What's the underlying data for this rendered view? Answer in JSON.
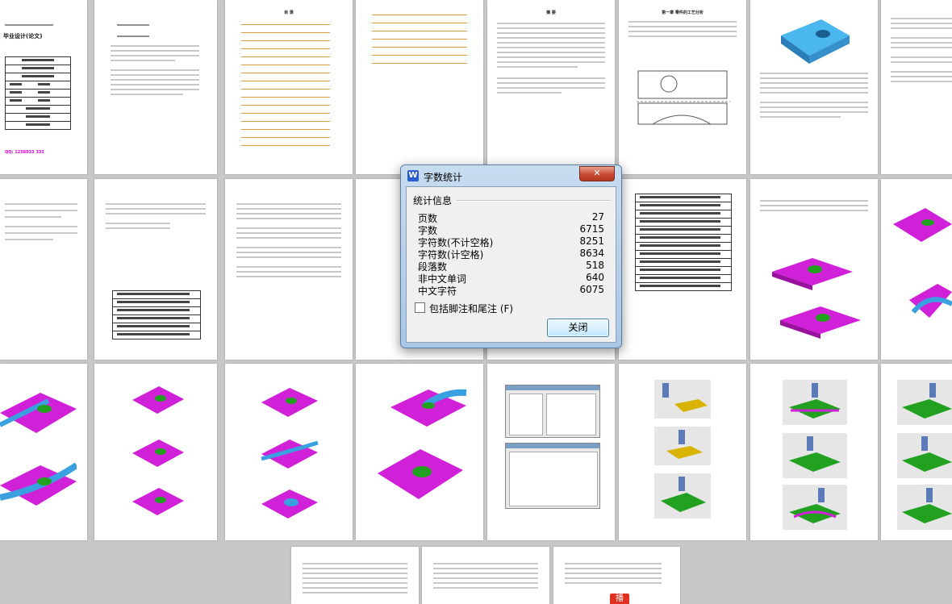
{
  "dialog": {
    "title": "字数统计",
    "close_glyph": "✕",
    "app_icon_letter": "W",
    "group_label": "统计信息",
    "stats": [
      {
        "label": "页数",
        "value": "27"
      },
      {
        "label": "字数",
        "value": "6715"
      },
      {
        "label": "字符数(不计空格)",
        "value": "8251"
      },
      {
        "label": "字符数(计空格)",
        "value": "8634"
      },
      {
        "label": "段落数",
        "value": "518"
      },
      {
        "label": "非中文单词",
        "value": "640"
      },
      {
        "label": "中文字符",
        "value": "6075"
      }
    ],
    "checkbox_label": "包括脚注和尾注 (F)",
    "checkbox_checked": false,
    "close_button_label": "关闭"
  },
  "pages": {
    "cover_title": "毕业设计(论文)",
    "cover_phone": "QQ: 1258933 333",
    "toc_title": "目 录",
    "abstract_title": "摘 要",
    "chapter_title": "第一章 零件的工艺分析",
    "stamp_text": "播"
  },
  "colors": {
    "part_magenta": "#d020d8",
    "part_green": "#22a020",
    "part_blue": "#3aa0e0",
    "toc_orange": "#e0902a",
    "stamp_red": "#e03020"
  }
}
